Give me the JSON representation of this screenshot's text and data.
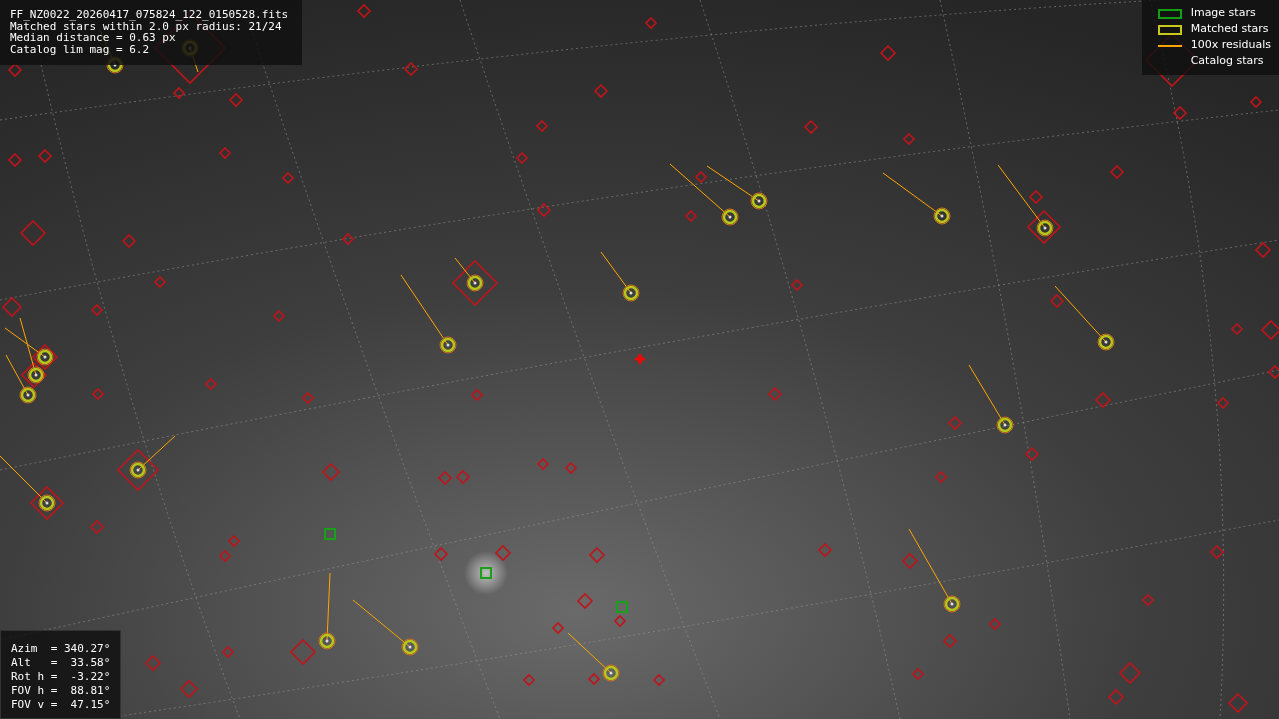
{
  "file_info": {
    "lines": [
      "FF_NZ0022_20260417_075824_122_0150528.fits",
      "Matched stars within 2.0 px radius: 21/24",
      "Median distance = 0.63 px",
      "Catalog lim mag = 6.2"
    ]
  },
  "legend": [
    {
      "kind": "image",
      "label": "Image stars"
    },
    {
      "kind": "matched",
      "label": "Matched stars"
    },
    {
      "kind": "residual",
      "label": "100x residuals"
    },
    {
      "kind": "catalog",
      "label": "Catalog stars"
    }
  ],
  "pointing": {
    "lines": [
      "Azim  = 340.27°",
      "Alt   =  33.58°",
      "Rot h =  -3.22°",
      "FOV h =  88.81°",
      "FOV v =  47.15°"
    ]
  }
}
